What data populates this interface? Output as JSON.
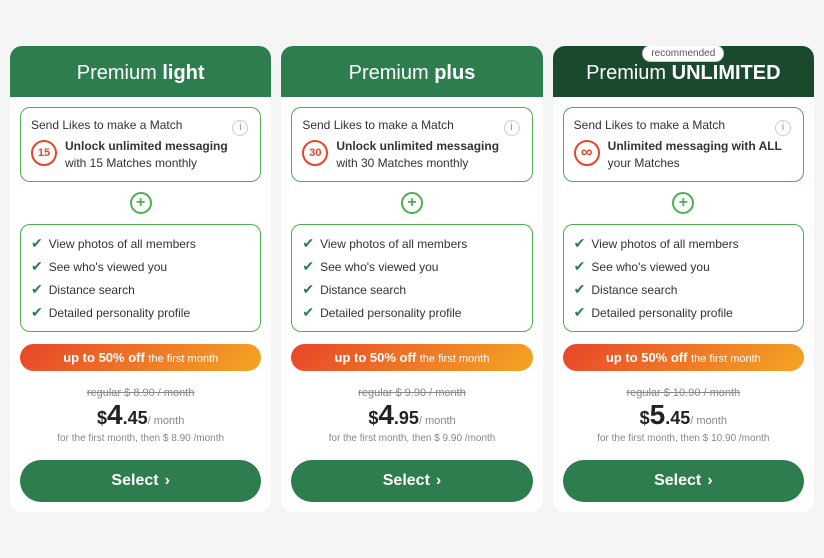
{
  "cards": [
    {
      "id": "light",
      "header_class": "light",
      "title_prefix": "Premium ",
      "title_bold": "light",
      "recommended": false,
      "top_feature": {
        "circle_label": "15",
        "circle_type": "number",
        "text_bold": "Unlock unlimited messaging",
        "text_regular": " with 15 Matches monthly"
      },
      "features": [
        "View photos of all members",
        "See who's viewed you",
        "Distance search",
        "Detailed personality profile"
      ],
      "discount_text": "up to 50% off",
      "discount_sub": "the first month",
      "regular_price": "regular $ 8.90 / month",
      "main_price_dollar": "$",
      "main_price_num": "4",
      "main_price_decimal": ".45",
      "per_month": "/ month",
      "then_price": "for the first month, then $ 8.90 /month",
      "select_label": "Select"
    },
    {
      "id": "plus",
      "header_class": "plus",
      "title_prefix": "Premium ",
      "title_bold": "plus",
      "recommended": false,
      "top_feature": {
        "circle_label": "30",
        "circle_type": "number",
        "text_bold": "Unlock unlimited messaging",
        "text_regular": " with 30 Matches monthly"
      },
      "features": [
        "View photos of all members",
        "See who's viewed you",
        "Distance search",
        "Detailed personality profile"
      ],
      "discount_text": "up to 50% off",
      "discount_sub": "the first month",
      "regular_price": "regular $ 9.90 / month",
      "main_price_dollar": "$",
      "main_price_num": "4",
      "main_price_decimal": ".95",
      "per_month": "/ month",
      "then_price": "for the first month, then $ 9.90 /month",
      "select_label": "Select"
    },
    {
      "id": "unlimited",
      "header_class": "unlimited",
      "title_prefix": "Premium ",
      "title_bold": "UNLIMITED",
      "recommended": true,
      "recommended_label": "recommended",
      "top_feature": {
        "circle_label": "∞",
        "circle_type": "infinity",
        "text_bold": "Unlimited messaging with ALL",
        "text_regular": " your Matches"
      },
      "features": [
        "View photos of all members",
        "See who's viewed you",
        "Distance search",
        "Detailed personality profile"
      ],
      "discount_text": "up to 50% off",
      "discount_sub": "the first month",
      "regular_price": "regular $ 10.90 / month",
      "main_price_dollar": "$",
      "main_price_num": "5",
      "main_price_decimal": ".45",
      "per_month": "/ month",
      "then_price": "for the first month, then $ 10.90 /month",
      "select_label": "Select"
    }
  ],
  "also_includes": "Send Likes to make a Match",
  "plus_symbol": "+",
  "info_symbol": "i",
  "check_symbol": "✔",
  "chevron_symbol": "›"
}
